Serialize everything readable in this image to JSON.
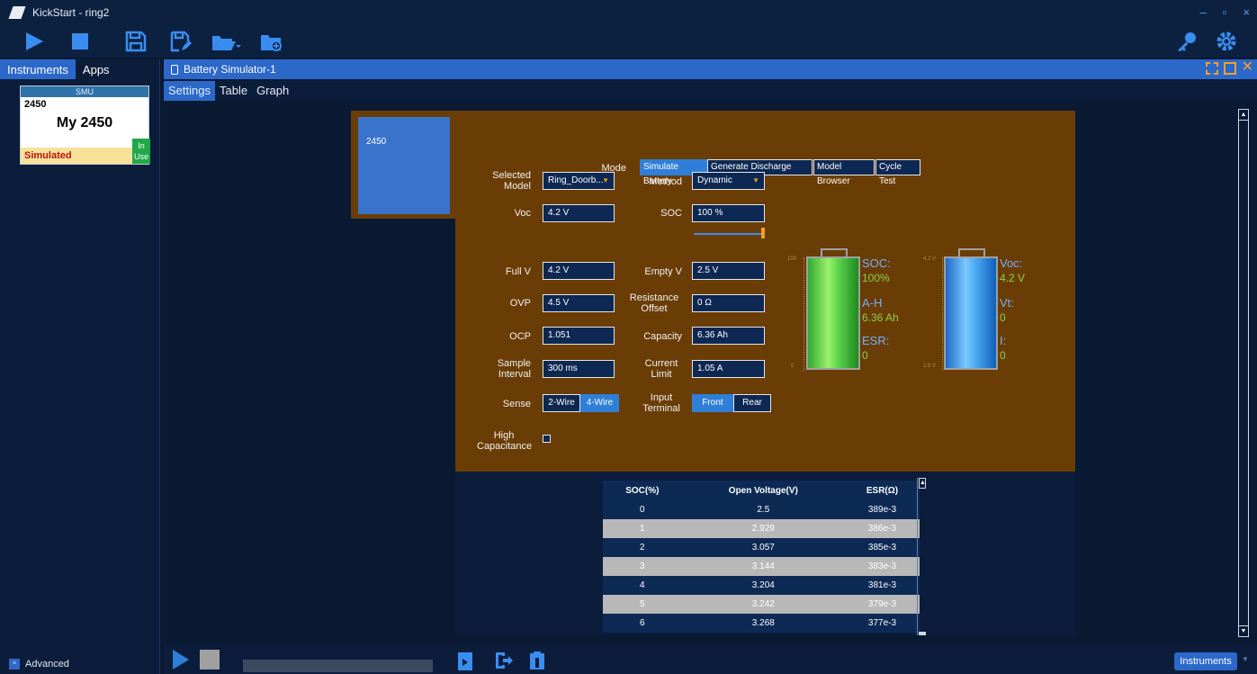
{
  "app": {
    "title": "KickStart - ring2"
  },
  "window_controls": {
    "minimize": "–",
    "restore": "▫",
    "close": "×"
  },
  "left_tabs": {
    "instruments": "Instruments",
    "apps": "Apps"
  },
  "smu_card": {
    "header": "SMU",
    "id": "2450",
    "name": "My 2450",
    "status": "Simulated",
    "in_use": "In Use"
  },
  "advanced": {
    "label": "Advanced"
  },
  "doc": {
    "title": "Battery Simulator-1"
  },
  "subtabs": [
    "Settings",
    "Table",
    "Graph"
  ],
  "device_label": "2450",
  "mode": {
    "label": "Mode",
    "options": [
      "Simulate Battery",
      "Generate Discharge Model",
      "Model Browser",
      "Cycle Test"
    ],
    "selected": "Simulate Battery"
  },
  "settings": {
    "selected_model_label": "Selected Model",
    "selected_model_value": "Ring_Doorb...",
    "method_label": "Method",
    "method_value": "Dynamic",
    "voc_label": "Voc",
    "voc_value": "4.2 V",
    "soc_label": "SOC",
    "soc_value": "100 %",
    "soc_slider": 1.0,
    "full_v_label": "Full V",
    "full_v_value": "4.2 V",
    "empty_v_label": "Empty V",
    "empty_v_value": "2.5 V",
    "ovp_label": "OVP",
    "ovp_value": "4.5 V",
    "resistance_offset_label": "Resistance Offset",
    "resistance_offset_value": "0 Ω",
    "ocp_label": "OCP",
    "ocp_value": "1.051",
    "capacity_label": "Capacity",
    "capacity_value": "6.36 Ah",
    "sample_interval_label": "Sample Interval",
    "sample_interval_value": "300 ms",
    "current_limit_label": "Current Limit",
    "current_limit_value": "1.05 A",
    "sense_label": "Sense",
    "sense_options": [
      "2-Wire",
      "4-Wire"
    ],
    "sense_selected": "4-Wire",
    "input_terminal_label": "Input Terminal",
    "input_terminal_options": [
      "Front",
      "Rear"
    ],
    "input_terminal_selected": "Front",
    "high_capacitance_label": "High Capacitance"
  },
  "soc_battery": {
    "scale_top": "100",
    "scale_bottom": "0",
    "soc_label": "SOC:",
    "soc_value": "100%",
    "ah_label": "A-H",
    "ah_value": "6.36 Ah",
    "esr_label": "ESR:",
    "esr_value": "0",
    "fill_fraction": 1.0
  },
  "voc_battery": {
    "scale_top": "4.2 V",
    "scale_bottom": "2.5 V",
    "voc_label": "Voc:",
    "voc_value": "4.2 V",
    "vt_label": "Vt:",
    "vt_value": "0",
    "i_label": "I:",
    "i_value": "0",
    "fill_fraction": 1.0
  },
  "table": {
    "headers": [
      "SOC(%)",
      "Open Voltage(V)",
      "ESR(Ω)"
    ],
    "rows": [
      [
        "0",
        "2.5",
        "389e-3"
      ],
      [
        "1",
        "2.929",
        "386e-3"
      ],
      [
        "2",
        "3.057",
        "385e-3"
      ],
      [
        "3",
        "3.144",
        "383e-3"
      ],
      [
        "4",
        "3.204",
        "381e-3"
      ],
      [
        "5",
        "3.242",
        "379e-3"
      ],
      [
        "6",
        "3.268",
        "377e-3"
      ]
    ]
  },
  "bottom": {
    "instruments_button": "Instruments"
  },
  "colors": {
    "accent": "#2b68c9",
    "panel": "#6a3d06",
    "battery_green": "#5ad44a",
    "battery_blue": "#4aa8f4"
  }
}
